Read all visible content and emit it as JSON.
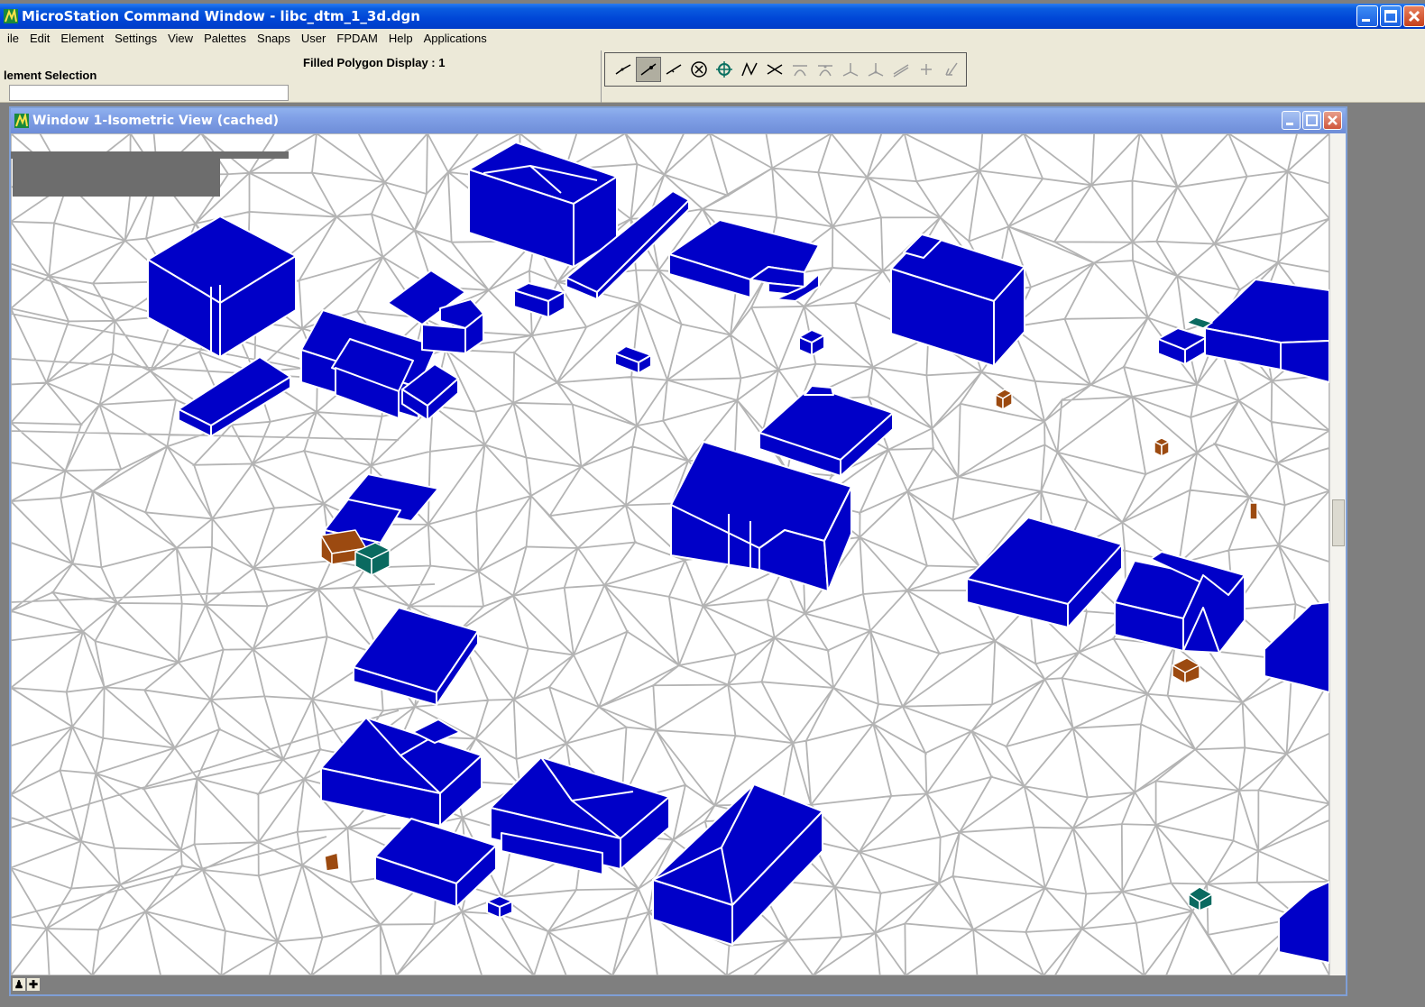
{
  "app": {
    "title": "MicroStation Command Window - libc_dtm_1_3d.dgn"
  },
  "menu": [
    "File",
    "Edit",
    "Element",
    "Settings",
    "View",
    "Palettes",
    "Snaps",
    "User",
    "FPDAM",
    "Help",
    "Applications"
  ],
  "menu_display": [
    "ile",
    "Edit",
    "Element",
    "Settings",
    "View",
    "Palettes",
    "Snaps",
    "User",
    "FPDAM",
    "Help",
    "Applications"
  ],
  "tool_area": {
    "element_selection_label": "lement Selection",
    "filled_polygon_label": "Filled Polygon Display : 1",
    "input_value": ""
  },
  "snaps": {
    "buttons": [
      "nearest-snap-icon",
      "keypoint-snap-icon",
      "midpoint-snap-icon",
      "center-snap-icon",
      "origin-snap-icon",
      "bisector-snap-icon",
      "intersection-snap-icon",
      "tangent-snap-icon",
      "tangent-point-snap-icon",
      "perpendicular-snap-icon",
      "perpendicular-point-snap-icon",
      "parallel-snap-icon",
      "through-point-snap-icon",
      "point-on-snap-icon"
    ],
    "active_index": 1
  },
  "view_window": {
    "title": "Window 1-Isometric View (cached)"
  },
  "colors": {
    "building": "#0000c8",
    "mesh": "#b4b4b4",
    "brown": "#9c4a10",
    "teal": "#0a6a60",
    "title_bar": "#0046d6",
    "view_title_bar": "#7f9fe6"
  }
}
